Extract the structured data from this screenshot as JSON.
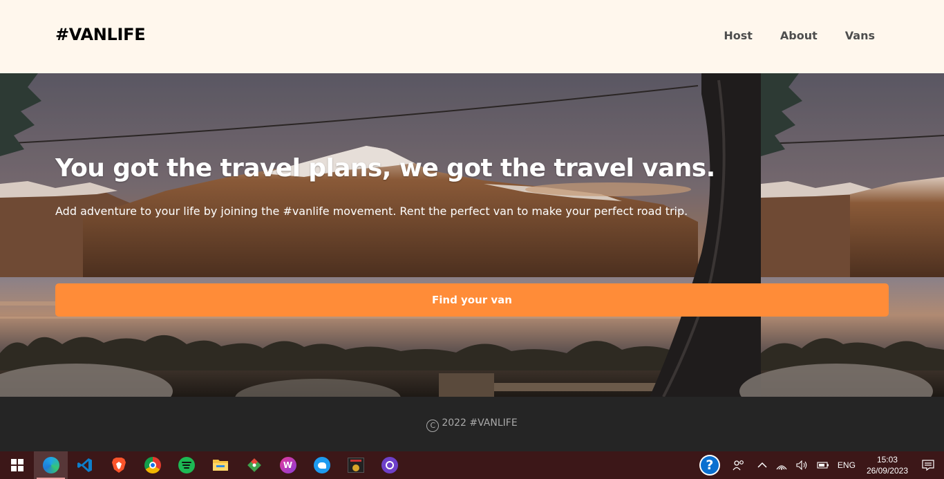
{
  "header": {
    "logo": "#VANLIFE",
    "nav": [
      "Host",
      "About",
      "Vans"
    ]
  },
  "hero": {
    "title": "You got the travel plans, we got the travel vans.",
    "subtitle": "Add adventure to your life by joining the #vanlife movement. Rent the perfect van to make your perfect road trip.",
    "cta_label": "Find your van"
  },
  "footer": {
    "copyright_symbol": "C",
    "text": "2022 #VANLIFE"
  },
  "taskbar": {
    "apps": [
      {
        "name": "start-icon",
        "active": false
      },
      {
        "name": "edge-icon",
        "active": true
      },
      {
        "name": "vscode-icon",
        "active": false
      },
      {
        "name": "brave-icon",
        "active": false
      },
      {
        "name": "chrome-icon",
        "active": false
      },
      {
        "name": "spotify-icon",
        "active": false
      },
      {
        "name": "file-explorer-icon",
        "active": false
      },
      {
        "name": "git-icon",
        "active": false
      },
      {
        "name": "wps-icon",
        "active": false
      },
      {
        "name": "twitter-icon",
        "active": false
      },
      {
        "name": "app-icon",
        "active": false
      },
      {
        "name": "github-icon",
        "active": false
      }
    ],
    "help_glyph": "?",
    "language": "ENG",
    "time": "15:03",
    "date": "26/09/2023"
  },
  "colors": {
    "header_bg": "#FFF7ED",
    "cta_bg": "#FF8C38",
    "footer_bg": "#252525",
    "taskbar_bg": "#3C1718"
  }
}
